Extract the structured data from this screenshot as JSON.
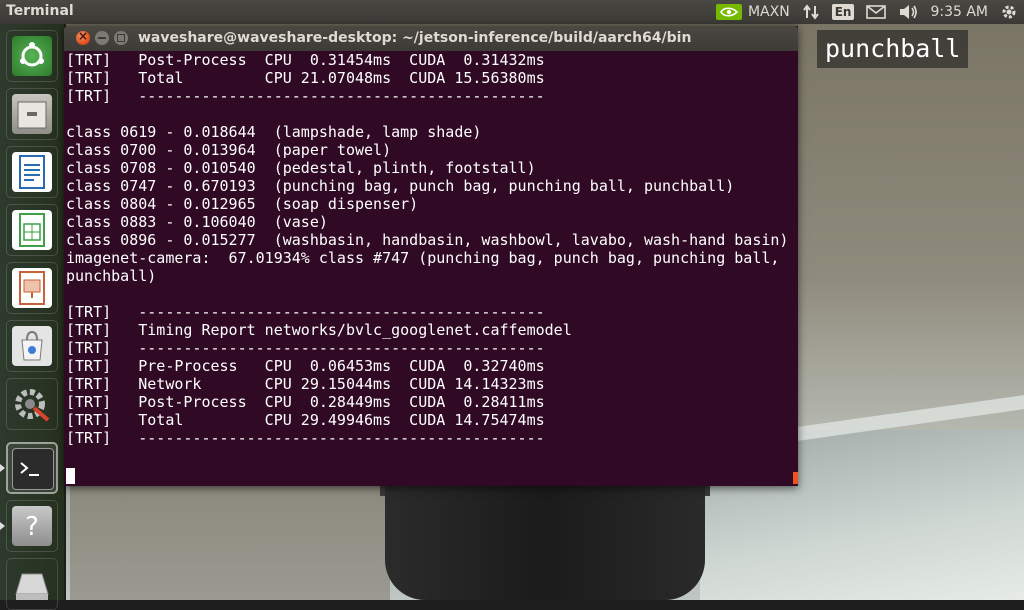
{
  "top_panel": {
    "app_title": "Terminal",
    "power_mode": "MAXN",
    "keyboard_layout": "En",
    "time": "9:35 AM",
    "icons": [
      "nvidia-icon",
      "network-arrows-icon",
      "mail-icon",
      "volume-icon",
      "settings-gear-icon"
    ]
  },
  "overlay": {
    "label": "punchball"
  },
  "launcher": {
    "items": [
      {
        "name": "ubuntu-dash-icon",
        "color": "#3b8b3a"
      },
      {
        "name": "files-icon",
        "color": "#9a9a96"
      },
      {
        "name": "libreoffice-writer-icon",
        "color": "#2b6cb0"
      },
      {
        "name": "libreoffice-calc-icon",
        "color": "#3ea148"
      },
      {
        "name": "libreoffice-impress-icon",
        "color": "#c9623a"
      },
      {
        "name": "software-center-icon",
        "color": "#dcdcdc"
      },
      {
        "name": "system-settings-icon",
        "color": "#8a8a8a"
      },
      {
        "name": "terminal-icon",
        "color": "#2b2b2b"
      },
      {
        "name": "help-icon",
        "color": "#9b9b9b"
      },
      {
        "name": "usb-drive-icon",
        "color": "#bbbbbb"
      }
    ]
  },
  "terminal": {
    "title": "waveshare@waveshare-desktop: ~/jetson-inference/build/aarch64/bin",
    "lines": [
      "[TRT]   Post-Process  CPU  0.31454ms  CUDA  0.31432ms",
      "[TRT]   Total         CPU 21.07048ms  CUDA 15.56380ms",
      "[TRT]   ---------------------------------------------",
      "",
      "class 0619 - 0.018644  (lampshade, lamp shade)",
      "class 0700 - 0.013964  (paper towel)",
      "class 0708 - 0.010540  (pedestal, plinth, footstall)",
      "class 0747 - 0.670193  (punching bag, punch bag, punching ball, punchball)",
      "class 0804 - 0.012965  (soap dispenser)",
      "class 0883 - 0.106040  (vase)",
      "class 0896 - 0.015277  (washbasin, handbasin, washbowl, lavabo, wash-hand basin)",
      "imagenet-camera:  67.01934% class #747 (punching bag, punch bag, punching ball,",
      "punchball)",
      "",
      "[TRT]   ---------------------------------------------",
      "[TRT]   Timing Report networks/bvlc_googlenet.caffemodel",
      "[TRT]   ---------------------------------------------",
      "[TRT]   Pre-Process   CPU  0.06453ms  CUDA  0.32740ms",
      "[TRT]   Network       CPU 29.15044ms  CUDA 14.14323ms",
      "[TRT]   Post-Process  CPU  0.28449ms  CUDA  0.28411ms",
      "[TRT]   Total         CPU 29.49946ms  CUDA 14.75474ms",
      "[TRT]   ---------------------------------------------"
    ]
  },
  "colors": {
    "terminal_bg": "#300a24",
    "accent": "#e95420",
    "nvidia_green": "#76b900"
  }
}
